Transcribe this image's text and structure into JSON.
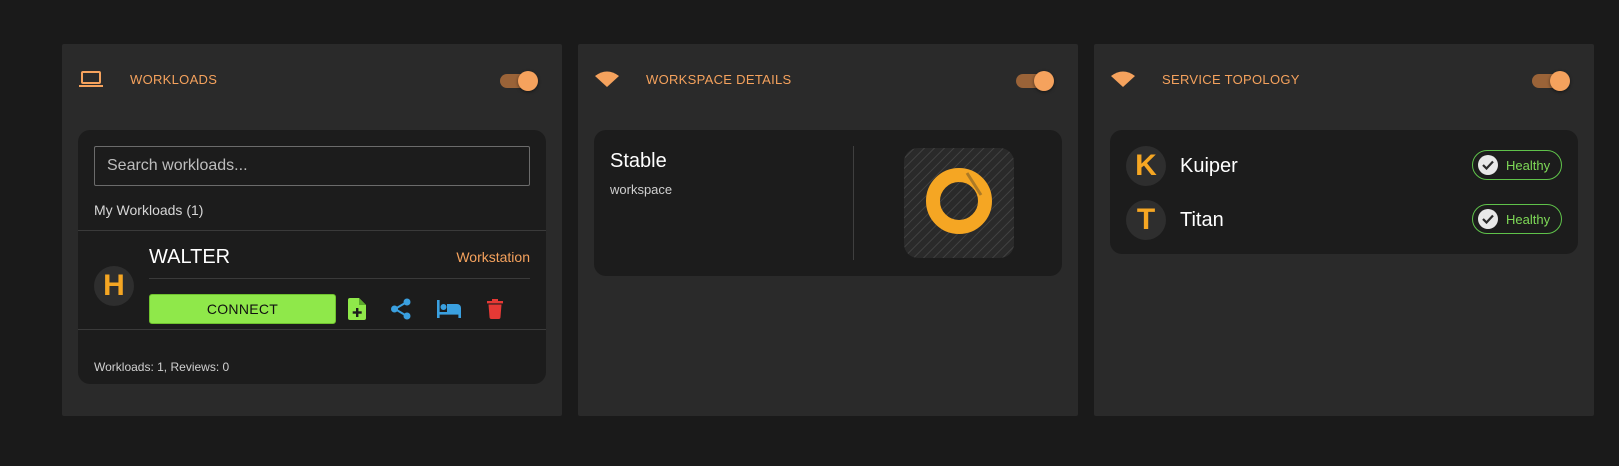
{
  "colors": {
    "accent": "#f5a25d",
    "connect": "#8fe84a",
    "share": "#3aa0e0",
    "delete": "#e53935",
    "healthy": "#7ed957"
  },
  "workloads_panel": {
    "icon": "laptop-icon",
    "title": "WORKLOADS",
    "toggle_on": true,
    "search": {
      "placeholder": "Search workloads...",
      "value": ""
    },
    "section_label": "My Workloads (1)",
    "items": [
      {
        "avatar_letter": "H",
        "name": "WALTER",
        "type": "Workstation",
        "connect_label": "CONNECT",
        "actions": [
          "add-file-icon",
          "share-icon",
          "bed-icon",
          "trash-icon"
        ]
      }
    ],
    "footer": "Workloads: 1, Reviews: 0"
  },
  "workspace_panel": {
    "icon": "wifi-icon",
    "title": "WORKSPACE DETAILS",
    "toggle_on": true,
    "name": "Stable",
    "subtitle": "workspace",
    "logo_icon": "ring-logo-icon"
  },
  "topology_panel": {
    "icon": "wifi-icon",
    "title": "SERVICE TOPOLOGY",
    "toggle_on": true,
    "services": [
      {
        "avatar_letter": "K",
        "name": "Kuiper",
        "status": "Healthy"
      },
      {
        "avatar_letter": "T",
        "name": "Titan",
        "status": "Healthy"
      }
    ]
  }
}
